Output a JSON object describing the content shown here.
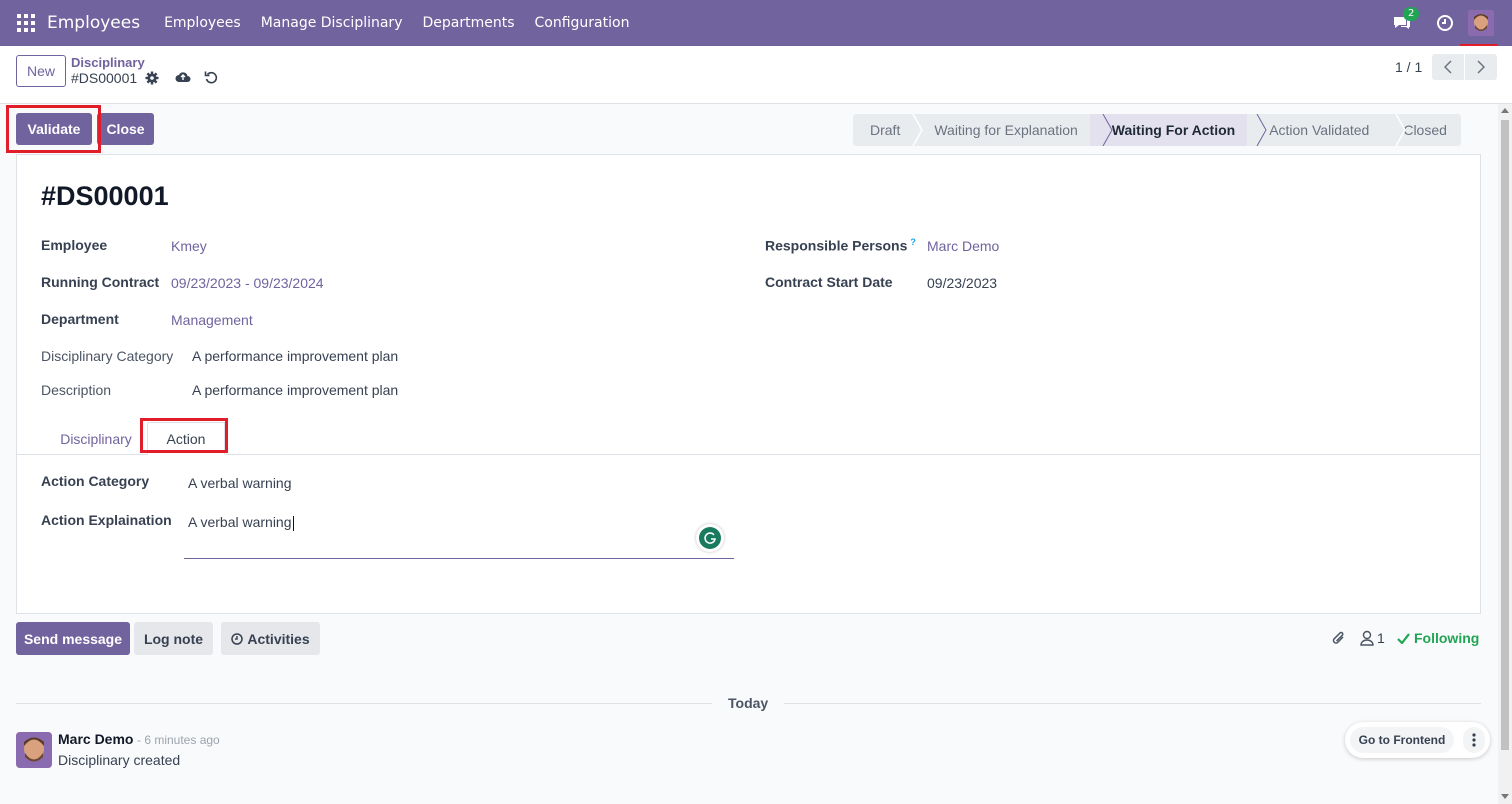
{
  "topnav": {
    "brand": "Employees",
    "menu": [
      "Employees",
      "Manage Disciplinary",
      "Departments",
      "Configuration"
    ],
    "chat_badge": "2",
    "icons": [
      "apps-grid-icon",
      "chat-icon",
      "clock-icon",
      "user-avatar"
    ]
  },
  "control": {
    "new_label": "New",
    "breadcrumb_parent": "Disciplinary",
    "breadcrumb_current": "#DS00001",
    "pager_value": "1 / 1"
  },
  "actions": {
    "validate_label": "Validate",
    "close_label": "Close"
  },
  "statusbar": {
    "stages": [
      "Draft",
      "Waiting for Explanation",
      "Waiting For Action",
      "Action Validated",
      "Closed"
    ],
    "active_stage": "Waiting For Action"
  },
  "form": {
    "title": "#DS00001",
    "employee_label": "Employee",
    "employee_value": "Kmey",
    "contract_label": "Running Contract",
    "contract_value": "09/23/2023 - 09/23/2024",
    "department_label": "Department",
    "department_value": "Management",
    "category_label": "Disciplinary Category",
    "category_value": "A performance improvement plan",
    "description_label": "Description",
    "description_value": "A performance improvement plan",
    "responsible_label": "Responsible Persons",
    "responsible_help": "?",
    "responsible_value": "Marc Demo",
    "contract_start_label": "Contract Start Date",
    "contract_start_value": "09/23/2023",
    "tabs": [
      "Disciplinary",
      "Action"
    ],
    "action_category_label": "Action Category",
    "action_category_value": "A verbal warning",
    "action_explanation_label": "Action Explaination",
    "action_explanation_value": "A verbal warning"
  },
  "chatter": {
    "send_label": "Send message",
    "log_label": "Log note",
    "activities_label": "Activities",
    "follower_count": "1",
    "following_label": "Following",
    "today_label": "Today",
    "message": {
      "author": "Marc Demo",
      "time": "- 6 minutes ago",
      "body": "Disciplinary created"
    }
  },
  "frontend": {
    "go_label": "Go to Frontend"
  },
  "colors": {
    "brand": "#71639e",
    "highlight": "#e11d2a",
    "following": "#22a455"
  }
}
